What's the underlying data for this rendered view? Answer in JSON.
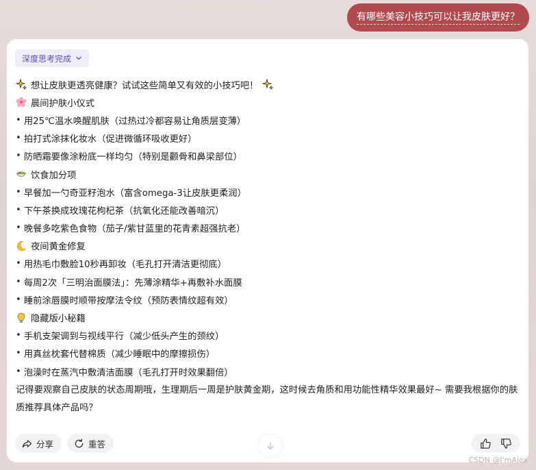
{
  "user_message": "有哪些美容小技巧可以让我皮肤更好？",
  "thinking_chip": "深度思考完成",
  "intro": "想让皮肤更透亮健康？试试这些简单又有效的小技巧吧！",
  "sections": [
    {
      "icon": "cherry-blossom-icon",
      "heading": "晨间护肤小仪式",
      "items": [
        "用25℃温水唤醒肌肤（过热过冷都容易让角质层变薄）",
        "拍打式涂抹化妆水（促进微循环吸收更好）",
        "防晒霜要像涂粉底一样均匀（特别是颧骨和鼻梁部位）"
      ]
    },
    {
      "icon": "salad-bowl-icon",
      "heading": "饮食加分项",
      "items": [
        "早餐加一勺奇亚籽泡水（富含omega-3让皮肤更柔润）",
        "下午茶换成玫瑰花枸杞茶（抗氧化还能改善暗沉）",
        "晚餐多吃紫色食物（茄子/紫甘蓝里的花青素超强抗老）"
      ]
    },
    {
      "icon": "crescent-moon-icon",
      "heading": "夜间黄金修复",
      "items": [
        "用热毛巾敷脸10秒再卸妆（毛孔打开清洁更彻底）",
        "每周2次「三明治面膜法」：先薄涂精华+再敷补水面膜",
        "睡前涂唇膜时顺带按摩法令纹（预防表情纹超有效）"
      ]
    },
    {
      "icon": "lightbulb-icon",
      "heading": "隐藏版小秘籍",
      "items": [
        "手机支架调到与视线平行（减少低头产生的颈纹）",
        "用真丝枕套代替棉质（减少睡眠中的摩擦损伤）",
        "泡澡时在蒸汽中敷清洁面膜（毛孔打开时效果翻倍）"
      ]
    }
  ],
  "closing": "记得要观察自己皮肤的状态周期哦，生理期后一周是护肤黄金期，这时候去角质和用功能性精华效果最好~ 需要我根据你的肤质推荐具体产品吗？",
  "actions": {
    "share": "分享",
    "regenerate": "重答"
  },
  "watermark": "CSDN @I'mAlex",
  "colors": {
    "user_bubble": "#b04a4e",
    "chip_bg": "#efedf8",
    "chip_text": "#5a4fc2",
    "background": "#e3d9d6"
  }
}
